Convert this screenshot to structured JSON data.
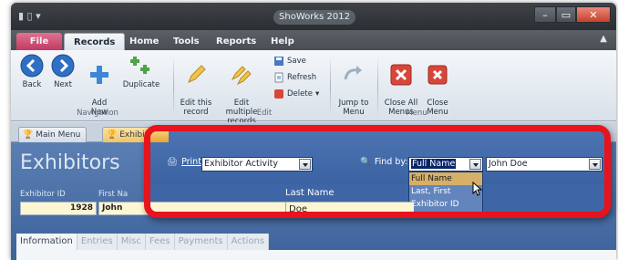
{
  "window": {
    "title": "ShoWorks 2012",
    "qat_icons": [
      "app-icon"
    ]
  },
  "ribbon": {
    "tabs": [
      "File",
      "Records",
      "Home",
      "Tools",
      "Reports",
      "Help"
    ],
    "active_tab": "Records",
    "groups": {
      "navigation": {
        "label": "Navigation",
        "buttons": [
          {
            "label": "Back",
            "icon": "back-arrow-icon"
          },
          {
            "label": "Next",
            "icon": "next-arrow-icon"
          },
          {
            "label": "Add\nNew",
            "icon": "add-icon"
          },
          {
            "label": "Duplicate",
            "icon": "duplicate-icon"
          }
        ]
      },
      "edit": {
        "label": "Edit",
        "buttons": [
          {
            "label": "Edit this\nrecord",
            "icon": "pencil-icon"
          },
          {
            "label": "Edit multiple\nrecords",
            "icon": "pencils-icon"
          }
        ],
        "small_buttons": [
          {
            "label": "Save",
            "icon": "save-icon"
          },
          {
            "label": "Refresh",
            "icon": "refresh-icon"
          },
          {
            "label": "Delete",
            "icon": "delete-icon"
          }
        ]
      },
      "jump": {
        "buttons": [
          {
            "label": "Jump to\nMenu",
            "icon": "jump-arrow-icon"
          }
        ]
      },
      "menu": {
        "label": "Menu",
        "buttons": [
          {
            "label": "Close All\nMenus",
            "icon": "close-all-icon"
          },
          {
            "label": "Close\nMenu",
            "icon": "close-menu-icon"
          }
        ]
      }
    }
  },
  "doc_tabs": [
    "Main Menu",
    "Exhibitors"
  ],
  "form": {
    "title": "Exhibitors",
    "exhibitor_id_label": "Exhibitor ID",
    "first_name_label": "First Na",
    "exhibitor_id_value": "1928",
    "first_name_value": "John",
    "subtabs": [
      "Information",
      "Entries",
      "Misc",
      "Fees",
      "Payments",
      "Actions"
    ],
    "active_subtab": "Information"
  },
  "zoom_panel": {
    "print_label": "Print:",
    "print_value": "Exhibitor Activity",
    "find_by_label": "Find by:",
    "find_by_value": "Full Name",
    "find_value": "John Doe",
    "find_by_options": [
      "Full Name",
      "Last, First",
      "Exhibitor ID"
    ],
    "hovered_option": "Full Name",
    "last_name_label": "Last Name",
    "last_name_value": "Doe",
    "highlight_color": "#e8131c"
  }
}
